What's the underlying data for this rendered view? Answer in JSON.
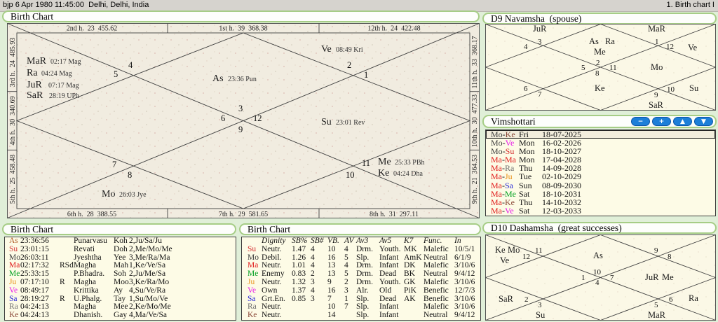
{
  "top_bar": {
    "left": "bjp 6 Apr 1980 11:45:00  Delhi, Delhi, India",
    "right": "1. Birth chart I"
  },
  "main_chart": {
    "title": "Birth Chart",
    "top": [
      "2nd h.  23  455.62",
      "1st h.  39  368.38",
      "12th h.  24  422.48"
    ],
    "bottom": [
      "6th h.  28  388.55",
      "7th h.  29  581.65",
      "8th h.  31  297.11"
    ],
    "left": [
      "3rd h.  24  485.93",
      "4th h.  30  340.69",
      "5th h.  25  458.48"
    ],
    "right": [
      "11th h.  33  368.17",
      "10th h.  30  477.33",
      "9th h.  21  364.53"
    ],
    "planets": [
      {
        "a": "MaR",
        "d": "02:17 Mag"
      },
      {
        "a": "Ra",
        "d": "04:24 Mag"
      },
      {
        "a": "JuR",
        "d": "07:17 Mag"
      },
      {
        "a": "SaR",
        "d": "28:19 UPh"
      },
      {
        "a": "Ve",
        "d": "08:49 Kri"
      },
      {
        "a": "As",
        "d": "23:36 Pun"
      },
      {
        "a": "Su",
        "d": "23:01 Rev"
      },
      {
        "a": "Mo",
        "d": "26:03 Jye"
      },
      {
        "a": "Me",
        "d": "25:33 PBh"
      },
      {
        "a": "Ke",
        "d": "04:24 Dha"
      }
    ],
    "houses": [
      "4",
      "5",
      "2",
      "1",
      "3",
      "6",
      "12",
      "9",
      "7",
      "8",
      "11",
      "10"
    ]
  },
  "d9": {
    "title": "D9 Navamsha  (spouse)",
    "planets": [
      "JuR",
      "As",
      "Ra",
      "Me",
      "MaR",
      "Ve",
      "Mo",
      "Ke",
      "Su",
      "SaR"
    ],
    "houses": [
      "3",
      "4",
      "2",
      "1",
      "12",
      "5",
      "11",
      "8",
      "6",
      "7",
      "9",
      "10"
    ]
  },
  "vimshottari": {
    "title": "Vimshottari",
    "buttons": [
      "−",
      "+",
      "▲",
      "▼"
    ],
    "rows": [
      {
        "a": "Mo",
        "b": "Ke",
        "day": "Fri",
        "date": "18-07-2025",
        "selected": true
      },
      {
        "a": "Mo",
        "b": "Ve",
        "day": "Mon",
        "date": "16-02-2026"
      },
      {
        "a": "Mo",
        "b": "Su",
        "day": "Mon",
        "date": "18-10-2027"
      },
      {
        "a": "Ma",
        "b": "Ma",
        "day": "Mon",
        "date": "17-04-2028"
      },
      {
        "a": "Ma",
        "b": "Ra",
        "day": "Thu",
        "date": "14-09-2028"
      },
      {
        "a": "Ma",
        "b": "Ju",
        "day": "Tue",
        "date": "02-10-2029"
      },
      {
        "a": "Ma",
        "b": "Sa",
        "day": "Sun",
        "date": "08-09-2030"
      },
      {
        "a": "Ma",
        "b": "Me",
        "day": "Sat",
        "date": "18-10-2031"
      },
      {
        "a": "Ma",
        "b": "Ke",
        "day": "Thu",
        "date": "14-10-2032"
      },
      {
        "a": "Ma",
        "b": "Ve",
        "day": "Sat",
        "date": "12-03-2033"
      }
    ]
  },
  "nak_table": {
    "title": "Birth Chart",
    "rows": [
      {
        "p": "As",
        "t": "23:36:56",
        "f": "",
        "n": "Punarvasu",
        "s": "Koh",
        "pos": "2,Ju/Sa/Ju"
      },
      {
        "p": "Su",
        "t": "23:01:15",
        "f": "",
        "n": "Revati",
        "s": "Doh",
        "pos": "2,Me/Mo/Me"
      },
      {
        "p": "Mo",
        "t": "26:03:11",
        "f": "",
        "n": "Jyeshtha",
        "s": "Yee",
        "pos": "3,Me/Ra/Ma"
      },
      {
        "p": "Ma",
        "t": "02:17:32",
        "f": "RSd",
        "n": "Magha",
        "s": "Mah",
        "pos": "1,Ke/Ve/Sa"
      },
      {
        "p": "Me",
        "t": "25:33:15",
        "f": "",
        "n": "P.Bhadra.",
        "s": "Soh",
        "pos": "2,Ju/Me/Sa"
      },
      {
        "p": "Ju",
        "t": "07:17:10",
        "f": "R",
        "n": "Magha",
        "s": "Moo",
        "pos": "3,Ke/Ra/Mo"
      },
      {
        "p": "Ve",
        "t": "08:49:17",
        "f": "",
        "n": "Krittika",
        "s": "Ay",
        "pos": "4,Su/Ve/Ra"
      },
      {
        "p": "Sa",
        "t": "28:19:27",
        "f": "R",
        "n": "U.Phalg.",
        "s": "Tay",
        "pos": "1,Su/Mo/Ve"
      },
      {
        "p": "Ra",
        "t": "04:24:13",
        "f": "",
        "n": "Magha",
        "s": "Mee",
        "pos": "2,Ke/Mo/Me"
      },
      {
        "p": "Ke",
        "t": "04:24:13",
        "f": "",
        "n": "Dhanish.",
        "s": "Gay",
        "pos": "4,Ma/Ve/Sa"
      }
    ]
  },
  "dig_table": {
    "title": "Birth Chart",
    "headers": [
      "Dignity",
      "SB%",
      "SB#",
      "VB.",
      "AV",
      "Av3",
      "Av5",
      "K7",
      "Func.",
      "In"
    ],
    "rows": [
      {
        "p": "Su",
        "c": [
          "Neutr.",
          "1.47",
          "4",
          "10",
          "4",
          "Drm.",
          "Youth.",
          "MK",
          "Malefic",
          "10/5/1"
        ]
      },
      {
        "p": "Mo",
        "c": [
          "Debil.",
          "1.26",
          "4",
          "16",
          "5",
          "Slp.",
          "Infant",
          "AmK",
          "Neutral",
          "6/1/9"
        ]
      },
      {
        "p": "Ma",
        "c": [
          "Neutr.",
          "1.01",
          "4",
          "13",
          "4",
          "Drm.",
          "Infant",
          "DK",
          "Malefic",
          "3/10/6"
        ]
      },
      {
        "p": "Me",
        "c": [
          "Enemy",
          "0.83",
          "2",
          "13",
          "5",
          "Drm.",
          "Dead",
          "BK",
          "Neutral",
          "9/4/12"
        ]
      },
      {
        "p": "Ju",
        "c": [
          "Neutr.",
          "1.32",
          "3",
          "9",
          "2",
          "Drm.",
          "Youth.",
          "GK",
          "Malefic",
          "3/10/6"
        ]
      },
      {
        "p": "Ve",
        "c": [
          "Own",
          "1.37",
          "4",
          "16",
          "3",
          "Alr.",
          "Old",
          "PiK",
          "Benefic",
          "12/7/3"
        ]
      },
      {
        "p": "Sa",
        "c": [
          "Grt.En.",
          "0.85",
          "3",
          "7",
          "1",
          "Slp.",
          "Dead",
          "AK",
          "Benefic",
          "3/10/6"
        ]
      },
      {
        "p": "Ra",
        "c": [
          "Neutr.",
          "",
          "",
          "10",
          "7",
          "Slp.",
          "Infant",
          "",
          "Malefic",
          "3/10/6"
        ]
      },
      {
        "p": "Ke",
        "c": [
          "Neutr.",
          "",
          "",
          "14",
          "",
          "Slp.",
          "Infant",
          "",
          "Neutral",
          "9/4/12"
        ]
      }
    ]
  },
  "d10": {
    "title": "D10 Dashamsha  (great successes)",
    "planets": [
      "Ke",
      "Mo",
      "Ve",
      "As",
      "JuR",
      "Me",
      "SaR",
      "Su",
      "Ra",
      "MaR"
    ],
    "houses": [
      "12",
      "11",
      "9",
      "8",
      "10",
      "1",
      "7",
      "4",
      "2",
      "3",
      "5",
      "6"
    ]
  },
  "colors": {
    "Su": "#d43030",
    "Mo": "#3c3c3c",
    "Ma": "#e01818",
    "Me": "#00a020",
    "Ju": "#e89018",
    "Ve": "#e818e8",
    "Sa": "#2828d8",
    "Ra": "#6f6f6f",
    "Ke": "#8a4838",
    "As": "#b05c28",
    "house_red": "#c75b5b",
    "accent_green": "#a6cd86",
    "button_blue": "#1d7fd8"
  }
}
